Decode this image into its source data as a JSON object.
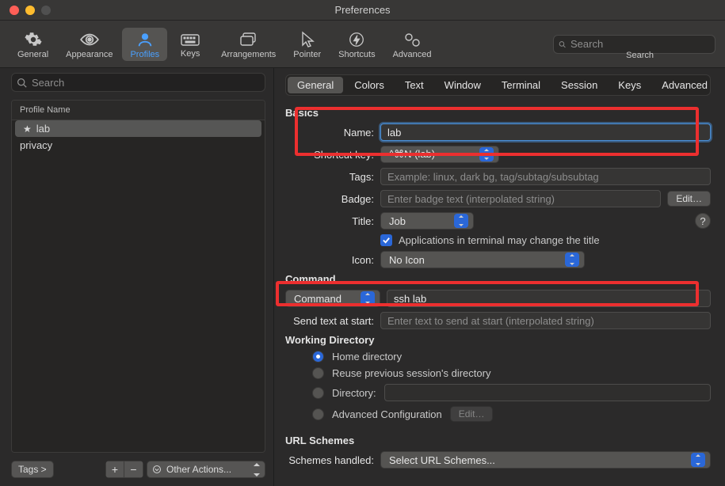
{
  "window": {
    "title": "Preferences"
  },
  "toolbar": {
    "items": [
      {
        "label": "General"
      },
      {
        "label": "Appearance"
      },
      {
        "label": "Profiles"
      },
      {
        "label": "Keys"
      },
      {
        "label": "Arrangements"
      },
      {
        "label": "Pointer"
      },
      {
        "label": "Shortcuts"
      },
      {
        "label": "Advanced"
      }
    ],
    "search_placeholder": "Search",
    "search_caption": "Search",
    "selected_index": 2
  },
  "left": {
    "search_placeholder": "Search",
    "profile_header": "Profile Name",
    "profiles": [
      {
        "label": "lab",
        "default": true,
        "selected": true
      },
      {
        "label": "privacy",
        "default": false,
        "selected": false
      }
    ],
    "tags_btn": "Tags >",
    "other_actions": "Other Actions..."
  },
  "right": {
    "tabs": [
      "General",
      "Colors",
      "Text",
      "Window",
      "Terminal",
      "Session",
      "Keys",
      "Advanced"
    ],
    "selected_tab": 0,
    "sections": {
      "basics_title": "Basics",
      "command_title": "Command",
      "working_title": "Working Directory",
      "url_title": "URL Schemes"
    },
    "labels": {
      "name": "Name:",
      "shortcut": "Shortcut key:",
      "tags": "Tags:",
      "badge": "Badge:",
      "title": "Title:",
      "appsChange": "Applications in terminal may change the title",
      "icon": "Icon:",
      "command": "Command",
      "commandField": "",
      "sendText": "Send text at start:",
      "home": "Home directory",
      "reuse": "Reuse previous session's directory",
      "directory": "Directory:",
      "advanced_cfg": "Advanced Configuration",
      "edit": "Edit…",
      "schemes": "Schemes handled:",
      "schemes_value": "Select URL Schemes..."
    },
    "values": {
      "name": "lab",
      "shortcut": "^⌘N (lab)",
      "tags_placeholder": "Example: linux, dark bg, tag/subtag/subsubtag",
      "badge_placeholder": "Enter badge text (interpolated string)",
      "title": "Job",
      "icon": "No Icon",
      "command_value": "ssh lab",
      "send_placeholder": "Enter text to send at start (interpolated string)"
    },
    "radio_selected": "home"
  }
}
